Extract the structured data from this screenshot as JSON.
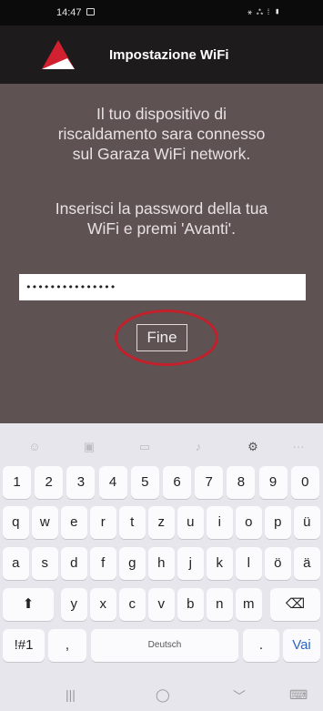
{
  "status": {
    "time": "14:47",
    "icons": "⚹ ⁂ ⁞ ▮"
  },
  "header": {
    "title": "Impostazione WiFi",
    "logo_colors": {
      "red": "#d1202f",
      "white": "#ffffff"
    }
  },
  "content": {
    "msg1": [
      "Il tuo dispositivo di",
      "riscaldamento sara connesso",
      "sul Garaza WiFi network."
    ],
    "msg2": [
      "Inserisci la password della tua",
      "WiFi e premi 'Avanti'."
    ],
    "password_value": "•••••••••••••••",
    "done_label": "Fine",
    "highlight_color": "#c2202b"
  },
  "keyboard": {
    "toolbar_icons": [
      "emoji-icon",
      "sticker-icon",
      "gif-icon",
      "microphone-icon",
      "settings-icon",
      "more-icon"
    ],
    "row_numbers": [
      "1",
      "2",
      "3",
      "4",
      "5",
      "6",
      "7",
      "8",
      "9",
      "0"
    ],
    "row1": [
      "q",
      "w",
      "e",
      "r",
      "t",
      "z",
      "u",
      "i",
      "o",
      "p",
      "ü"
    ],
    "row2": [
      "a",
      "s",
      "d",
      "f",
      "g",
      "h",
      "j",
      "k",
      "l",
      "ö",
      "ä"
    ],
    "row3": [
      "y",
      "x",
      "c",
      "v",
      "b",
      "n",
      "m"
    ],
    "shift_label": "⬆",
    "backspace_label": "⌫",
    "symbols_label": "!#1",
    "comma_label": ",",
    "space_label": "Deutsch",
    "period_label": ".",
    "go_label": "Vai"
  },
  "navbar": {
    "recent": "|||",
    "home": "◯",
    "back": "﹀",
    "keyboard": "⌨"
  }
}
